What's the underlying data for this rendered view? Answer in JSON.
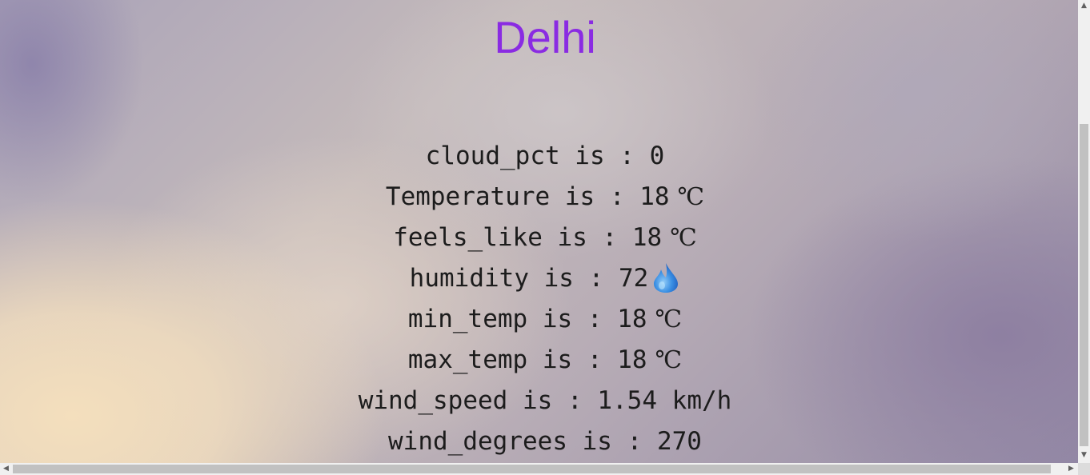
{
  "city": "Delhi",
  "colors": {
    "title": "#8a2be2",
    "text": "#1c1c1c"
  },
  "weather": {
    "cloud_pct": {
      "label": "cloud_pct is :",
      "value": "0"
    },
    "temp": {
      "label": "Temperature is :",
      "value": "18",
      "unit": "℃"
    },
    "feels_like": {
      "label": "feels_like is :",
      "value": "18",
      "unit": "℃"
    },
    "humidity": {
      "label": "humidity is :",
      "value": "72",
      "icon": "water-drop-icon"
    },
    "min_temp": {
      "label": "min_temp is :",
      "value": "18",
      "unit": "℃"
    },
    "max_temp": {
      "label": "max_temp is :",
      "value": "18",
      "unit": "℃"
    },
    "wind_speed": {
      "label": "wind_speed is :",
      "value": "1.54",
      "unit": "km/h"
    },
    "wind_degrees": {
      "label": "wind_degrees is :",
      "value": "270"
    }
  },
  "scrollbars": {
    "up_arrow": "▲",
    "down_arrow": "▼",
    "left_arrow": "◀",
    "right_arrow": "▶"
  }
}
